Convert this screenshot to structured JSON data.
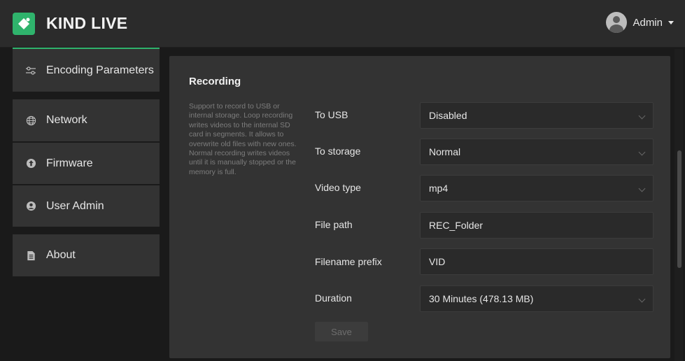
{
  "header": {
    "brand": "KIND LIVE",
    "user_name": "Admin",
    "accent_color": "#2fb36c"
  },
  "sidebar": {
    "items": [
      {
        "label": "Encoding Parameters",
        "icon": "sliders-icon"
      },
      {
        "label": "Network",
        "icon": "globe-icon"
      },
      {
        "label": "Firmware",
        "icon": "upload-icon"
      },
      {
        "label": "User Admin",
        "icon": "user-icon"
      },
      {
        "label": "About",
        "icon": "document-icon"
      }
    ]
  },
  "recording": {
    "title": "Recording",
    "description": "Support to record to USB or internal storage. Loop recording writes videos to the internal SD card in segments. It allows to overwrite old files with new ones. Normal recording writes videos until it is manually stopped or the memory is full.",
    "fields": [
      {
        "label": "To USB",
        "value": "Disabled",
        "type": "select"
      },
      {
        "label": "To storage",
        "value": "Normal",
        "type": "select"
      },
      {
        "label": "Video type",
        "value": "mp4",
        "type": "select"
      },
      {
        "label": "File path",
        "value": "REC_Folder",
        "type": "text"
      },
      {
        "label": "Filename prefix",
        "value": "VID",
        "type": "text"
      },
      {
        "label": "Duration",
        "value": "30 Minutes (478.13 MB)",
        "type": "select"
      }
    ],
    "save_label": "Save"
  }
}
